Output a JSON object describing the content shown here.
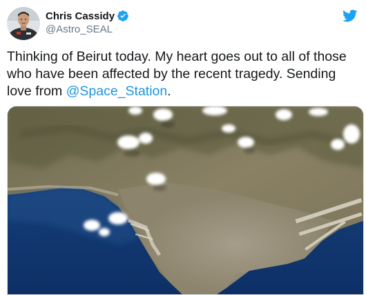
{
  "author": {
    "display_name": "Chris Cassidy",
    "handle": "@Astro_SEAL",
    "verified": true,
    "avatar_icon": "astronaut-avatar-icon",
    "verified_icon": "verified-badge-icon"
  },
  "platform_icon": "twitter-bird-icon",
  "tweet": {
    "text_part1": "Thinking of Beirut today. My heart goes out to all of those who have been affected by the recent tragedy. Sending love from ",
    "mention": "@Space_Station",
    "text_part2": "."
  },
  "media": {
    "type": "photo",
    "subject": "satellite-photo-of-beirut-coastline"
  },
  "colors": {
    "link": "#1b95e0",
    "verified": "#1da1f2",
    "handle": "#657786",
    "text": "#14171a"
  }
}
